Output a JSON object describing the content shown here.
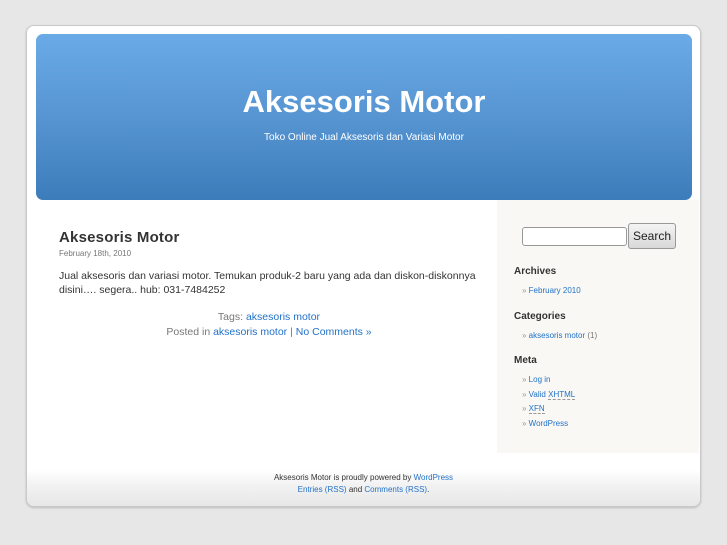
{
  "header": {
    "title": "Aksesoris Motor",
    "description": "Toko Online Jual Aksesoris dan Variasi Motor"
  },
  "post": {
    "title": "Aksesoris Motor",
    "date": "February 18th, 2010",
    "body": "Jual aksesoris dan variasi motor. Temukan produk-2 baru yang ada dan diskon-diskonnya disini…. segera.. hub: 031-7484252",
    "tags_label": "Tags:",
    "tag": "aksesoris motor",
    "posted_label": "Posted in",
    "category": "aksesoris motor",
    "separator": "|",
    "comments": "No Comments »"
  },
  "sidebar": {
    "search_button": "Search",
    "search_value": "",
    "archives": {
      "title": "Archives",
      "items": [
        "February 2010"
      ]
    },
    "categories": {
      "title": "Categories",
      "item": "aksesoris motor",
      "count": "(1)"
    },
    "meta": {
      "title": "Meta",
      "login": "Log in",
      "valid": "Valid",
      "xhtml": "XHTML",
      "xfn": "XFN",
      "wordpress": "WordPress"
    }
  },
  "footer": {
    "text": "Aksesoris Motor is proudly powered by",
    "wordpress": "WordPress",
    "entries": "Entries (RSS)",
    "and": "and",
    "comments": "Comments (RSS)",
    "dot": "."
  }
}
